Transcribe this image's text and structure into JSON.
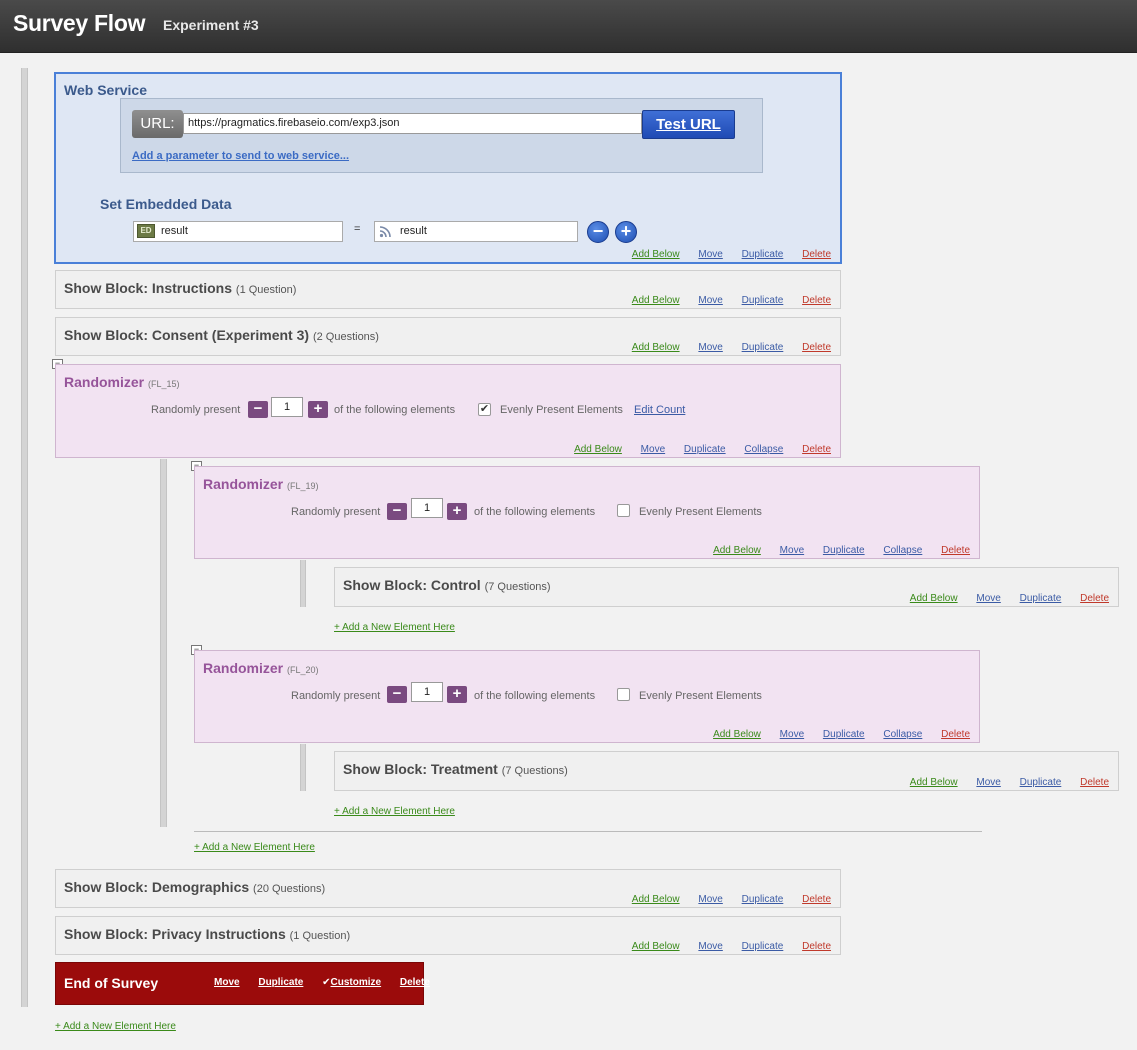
{
  "header": {
    "title": "Survey Flow",
    "subtitle": "Experiment #3"
  },
  "actions": {
    "add_below": "Add Below",
    "move": "Move",
    "duplicate": "Duplicate",
    "collapse": "Collapse",
    "delete": "Delete",
    "edit_count": "Edit Count",
    "customize": "Customize"
  },
  "web_service": {
    "title": "Web Service",
    "url_label": "URL:",
    "url_value": "https://pragmatics.firebaseio.com/exp3.json",
    "test_button": "Test URL",
    "param_link": "Add a parameter to send to web service...",
    "embedded_title": "Set Embedded Data",
    "ed_badge": "ED",
    "embed_left": "result",
    "equals": "=",
    "embed_right": "result"
  },
  "blocks": {
    "instructions": {
      "name": "Show Block: Instructions",
      "count": "(1 Question)"
    },
    "consent": {
      "name": "Show Block: Consent (Experiment 3)",
      "count": "(2 Questions)"
    },
    "control": {
      "name": "Show Block: Control",
      "count": "(7 Questions)"
    },
    "treatment": {
      "name": "Show Block: Treatment",
      "count": "(7 Questions)"
    },
    "demographics": {
      "name": "Show Block: Demographics",
      "count": "(20 Questions)"
    },
    "privacy": {
      "name": "Show Block: Privacy Instructions",
      "count": "(1 Question)"
    }
  },
  "randomizers": {
    "common": {
      "title": "Randomizer",
      "present_label": "Randomly present",
      "following_label": "of the following elements",
      "evenly_label": "Evenly Present Elements",
      "minus": "−",
      "plus": "+"
    },
    "r1": {
      "id": "(FL_15)",
      "count": "1",
      "evenly_checked": "✔"
    },
    "r2": {
      "id": "(FL_19)",
      "count": "1"
    },
    "r3": {
      "id": "(FL_20)",
      "count": "1"
    }
  },
  "add_element": "+ Add a New Element Here",
  "end": {
    "title": "End of Survey"
  }
}
